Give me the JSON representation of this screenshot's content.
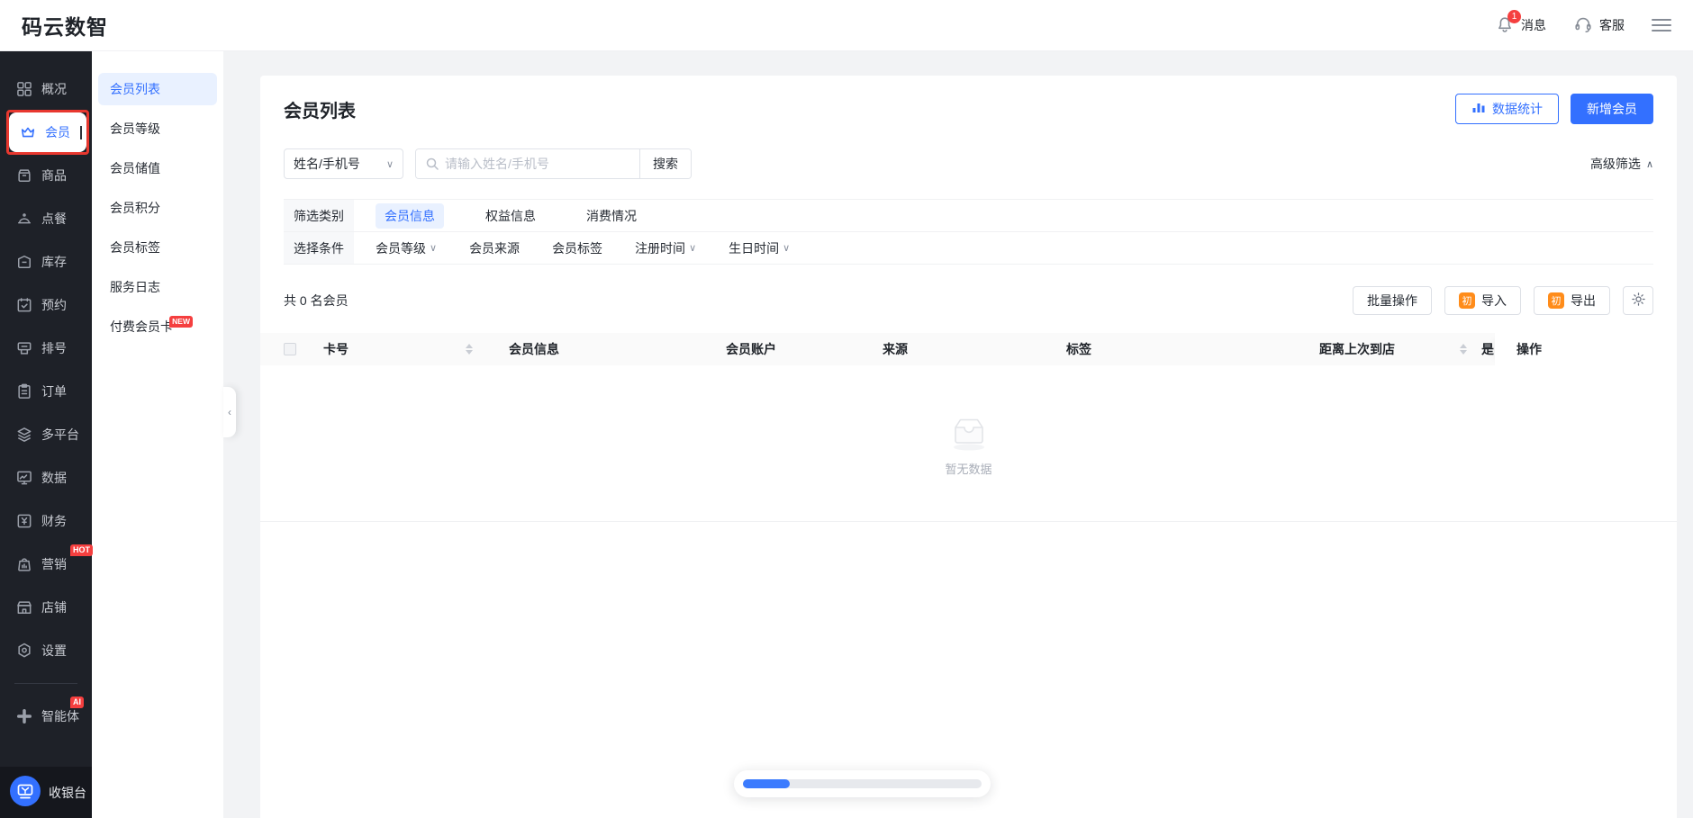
{
  "app": {
    "title": "码云数智"
  },
  "header": {
    "messages": {
      "label": "消息",
      "badge": "1"
    },
    "support": {
      "label": "客服"
    }
  },
  "sidebar": {
    "items": [
      {
        "label": "概况"
      },
      {
        "label": "会员"
      },
      {
        "label": "商品"
      },
      {
        "label": "点餐"
      },
      {
        "label": "库存"
      },
      {
        "label": "预约"
      },
      {
        "label": "排号"
      },
      {
        "label": "订单"
      },
      {
        "label": "多平台"
      },
      {
        "label": "数据"
      },
      {
        "label": "财务"
      },
      {
        "label": "营销",
        "badge": "HOT"
      },
      {
        "label": "店铺"
      },
      {
        "label": "设置"
      },
      {
        "label": "智能体",
        "badge": "AI"
      }
    ],
    "cashier": {
      "label": "收银台"
    }
  },
  "submenu": {
    "items": [
      {
        "label": "会员列表"
      },
      {
        "label": "会员等级"
      },
      {
        "label": "会员储值"
      },
      {
        "label": "会员积分"
      },
      {
        "label": "会员标签"
      },
      {
        "label": "服务日志"
      },
      {
        "label": "付费会员卡",
        "badge": "NEW"
      }
    ]
  },
  "page": {
    "title": "会员列表",
    "actions": {
      "stats": "数据统计",
      "add": "新增会员"
    },
    "search": {
      "field": "姓名/手机号",
      "placeholder": "请输入姓名/手机号",
      "button": "搜索",
      "advanced": "高级筛选"
    },
    "filters": {
      "category_label": "筛选类别",
      "categories": [
        "会员信息",
        "权益信息",
        "消费情况"
      ],
      "condition_label": "选择条件",
      "conditions": [
        "会员等级",
        "会员来源",
        "会员标签",
        "注册时间",
        "生日时间"
      ]
    },
    "toolbar": {
      "count": "共 0 名会员",
      "batch": "批量操作",
      "import": "导入",
      "export": "导出",
      "tpl_badge": "初"
    },
    "table": {
      "columns": {
        "card_no": "卡号",
        "member_info": "会员信息",
        "member_account": "会员账户",
        "source": "来源",
        "tags": "标签",
        "last_visit": "距离上次到店",
        "cut": "是",
        "operations": "操作"
      },
      "empty": "暂无数据"
    }
  },
  "colors": {
    "primary": "#3370ff",
    "danger": "#f53f3f",
    "orange": "#ff8c1a",
    "annotation": "#e8382f"
  }
}
